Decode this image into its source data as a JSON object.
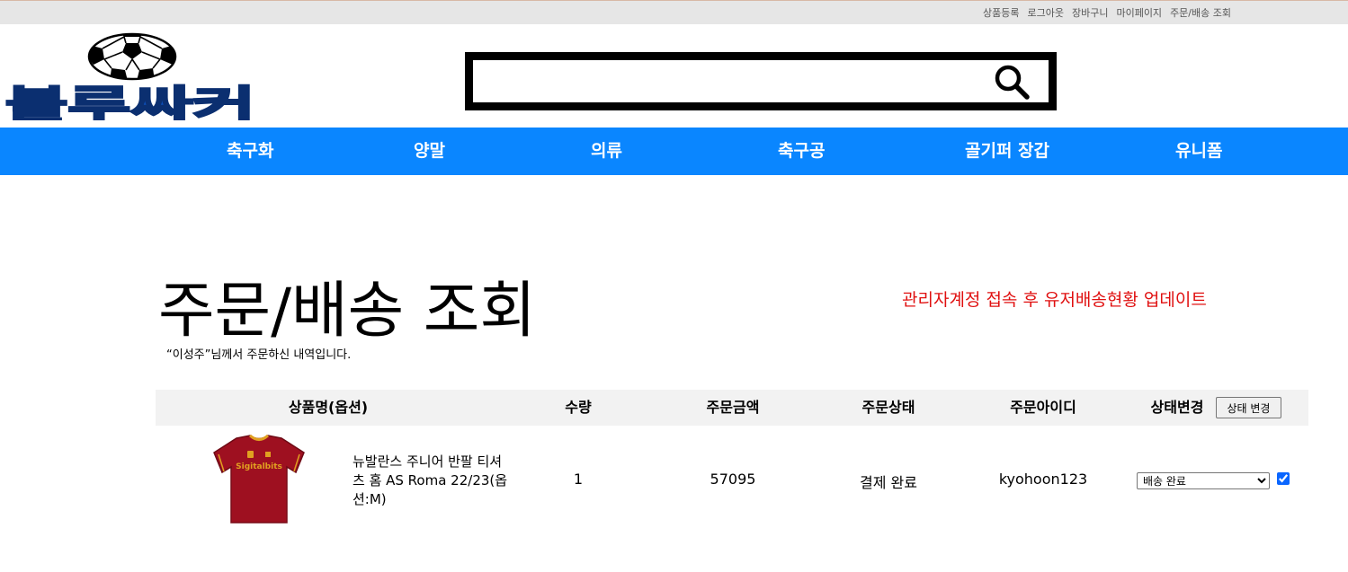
{
  "top_links": [
    "상품등록",
    "로그아웃",
    "장바구니",
    "마이페이지",
    "주문/배송 조회"
  ],
  "logo": {
    "text": "블루싸커"
  },
  "search": {
    "value": "",
    "placeholder": ""
  },
  "nav": [
    "축구화",
    "양말",
    "의류",
    "축구공",
    "골기퍼 장갑",
    "유니폼"
  ],
  "page": {
    "title": "주문/배송 조회",
    "subtitle": "“이성주”님께서 주문하신 내역입니다.",
    "notice": "관리자계정 접속 후 유저배송현황 업데이트"
  },
  "table": {
    "headers": [
      "상품명(옵션)",
      "수량",
      "주문금액",
      "주문상태",
      "주문아이디",
      "상태변경"
    ],
    "status_button": "상태 변경",
    "rows": [
      {
        "product_name": "뉴발란스 주니어 반팔 티셔츠 홈 AS Roma 22/23(옵션:M)",
        "quantity": "1",
        "amount": "57095",
        "status": "결제 완료",
        "user_id": "kyohoon123",
        "select_value": "배송 완료",
        "checked": true,
        "shirt_text": "Sigitalbits"
      }
    ]
  },
  "colors": {
    "nav": "#0a86ff",
    "notice": "#e01010",
    "logo": "#0d4fb8",
    "shirt": "#9e1020"
  }
}
